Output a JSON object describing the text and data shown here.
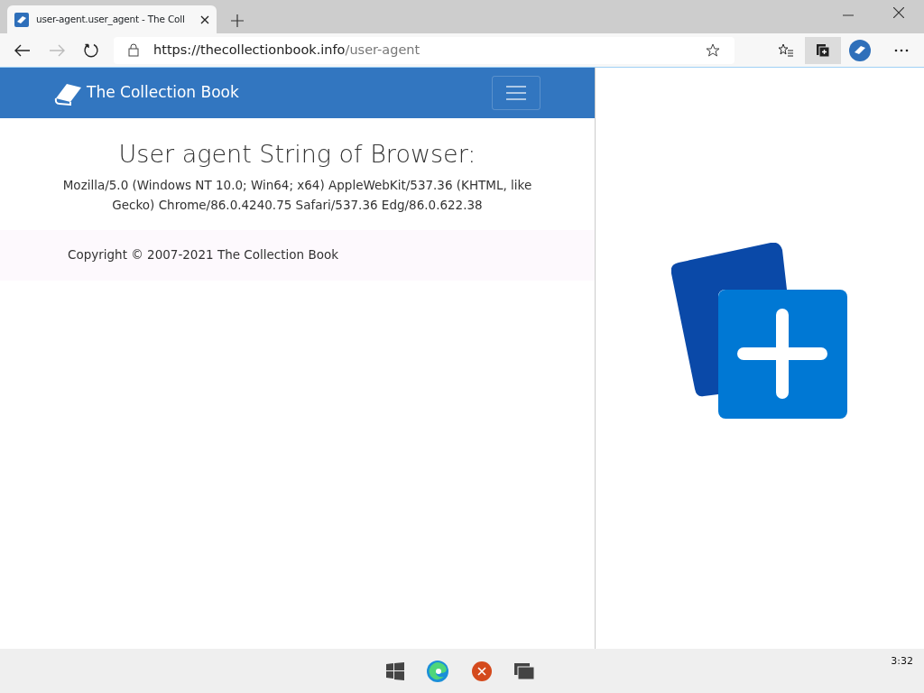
{
  "browser": {
    "tab": {
      "title": "user-agent.user_agent - The Coll",
      "selected": true
    },
    "url": {
      "host": "https://thecollectionbook.info",
      "path": "/user-agent"
    }
  },
  "site": {
    "brand": "The Collection Book",
    "heading": "User agent String of Browser:",
    "user_agent": "Mozilla/5.0 (Windows NT 10.0; Win64; x64) AppleWebKit/537.36 (KHTML, like Gecko) Chrome/86.0.4240.75 Safari/537.36 Edg/86.0.622.38",
    "footer": "Copyright © 2007-2021 The Collection Book"
  },
  "taskbar": {
    "clock": "3:32"
  }
}
